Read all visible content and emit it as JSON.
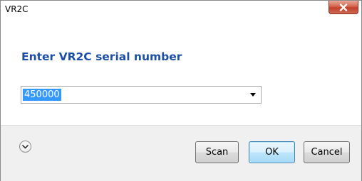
{
  "window": {
    "title": "VR2C"
  },
  "titlebar": {
    "close_icon": "close-icon"
  },
  "main": {
    "heading": "Enter VR2C serial number",
    "serial_combo": {
      "value": "450000",
      "arrow_icon": "chevron-down-icon"
    }
  },
  "footer": {
    "details_icon": "expand-details-icon",
    "buttons": {
      "scan": "Scan",
      "ok": "OK",
      "cancel": "Cancel"
    }
  },
  "colors": {
    "heading": "#1c4fa5",
    "selection": "#3399ff",
    "close_button": "#c2402a",
    "footer_bg": "#f0f0f0"
  }
}
